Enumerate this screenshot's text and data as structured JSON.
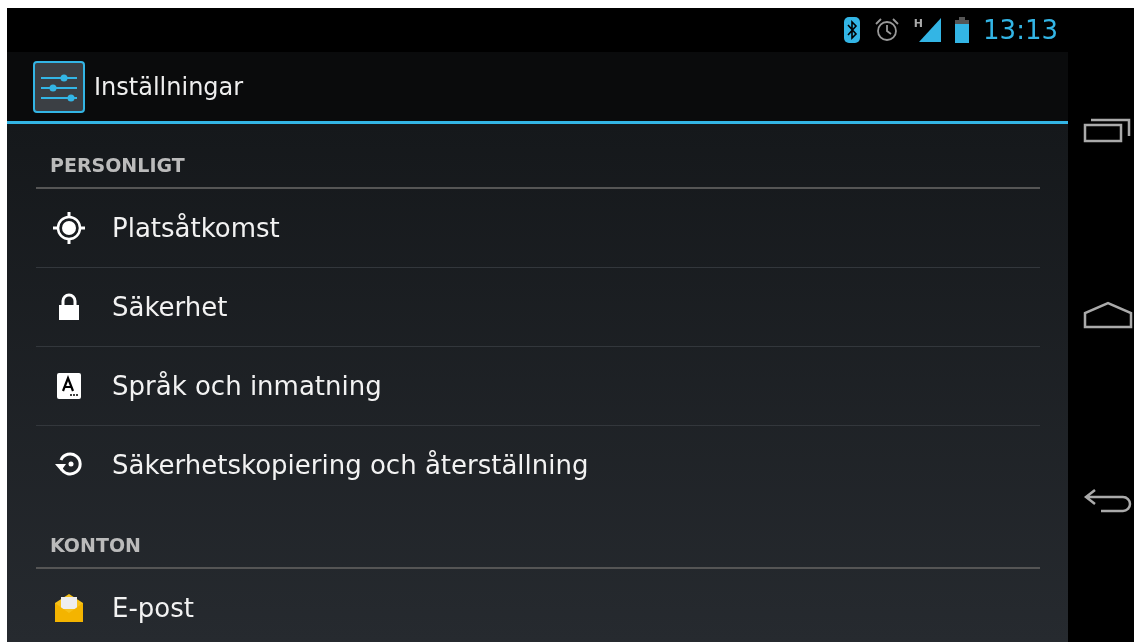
{
  "status_bar": {
    "time": "13:13",
    "network_type": "H"
  },
  "action_bar": {
    "title": "Inställningar"
  },
  "sections": [
    {
      "header": "PERSONLIGT",
      "items": [
        {
          "label": "Platsåtkomst",
          "kind": "location"
        },
        {
          "label": "Säkerhet",
          "kind": "lock"
        },
        {
          "label": "Språk och inmatning",
          "kind": "language"
        },
        {
          "label": "Säkerhetskopiering och återställning",
          "kind": "backup"
        }
      ]
    },
    {
      "header": "KONTON",
      "items": [
        {
          "label": "E-post",
          "kind": "email"
        }
      ]
    }
  ]
}
